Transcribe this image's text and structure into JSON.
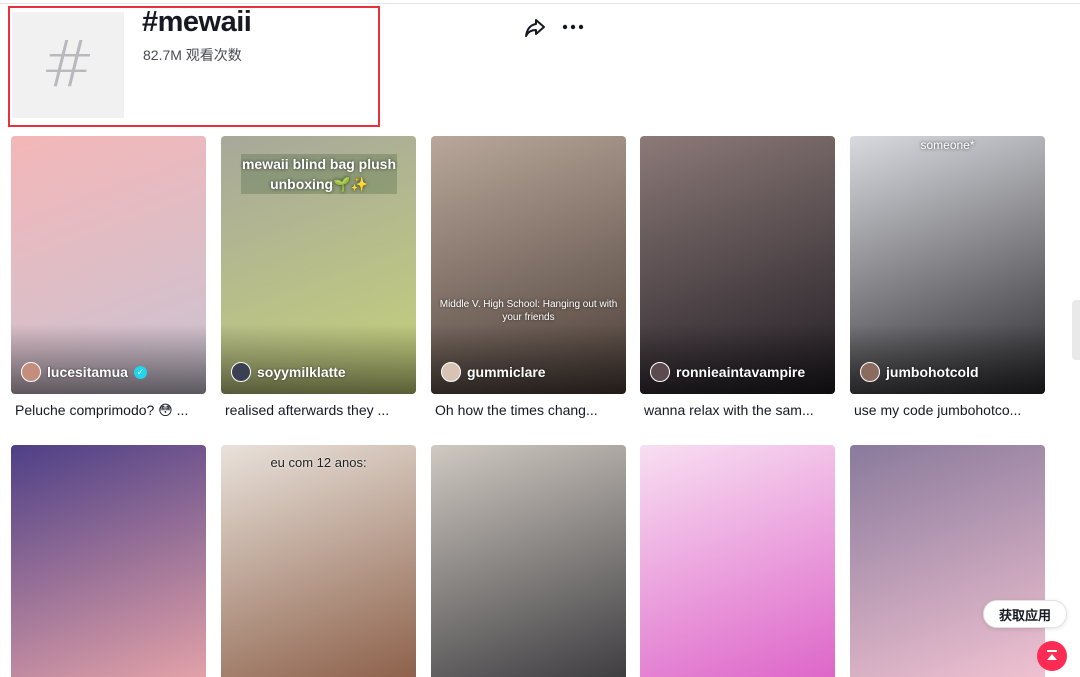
{
  "tag": {
    "title": "#mewaii",
    "views": "82.7M 观看次数",
    "icon": "hashtag-icon"
  },
  "actions": {
    "share_icon": "share-arrow-icon",
    "more_icon": "more-dots-icon"
  },
  "videos": [
    {
      "username": "lucesitamua",
      "verified": true,
      "caption": "Peluche comprimodo? 😳 ...",
      "overlay": "",
      "bg": "#f4b7b8",
      "bg2": "#c9c3d3"
    },
    {
      "username": "soyymilklatte",
      "verified": false,
      "caption": "realised afterwards they ...",
      "overlay": "mewaii blind bag plush unboxing🌱✨",
      "bg": "#a7a89b",
      "bg2": "#c7d27a"
    },
    {
      "username": "gummiclare",
      "verified": false,
      "caption": "Oh how the times chang...",
      "overlay": "Middle V. High School: Hanging out with your friends",
      "bg": "#b9a79a",
      "bg2": "#4a3d37"
    },
    {
      "username": "ronnieaintavampire",
      "verified": false,
      "caption": "wanna relax with the sam...",
      "overlay": "",
      "bg": "#8c7a78",
      "bg2": "#1f1b22"
    },
    {
      "username": "jumbohotcold",
      "verified": false,
      "caption": "use my code jumbohotco...",
      "overlay": "someone*",
      "bg": "#d9dadf",
      "bg2": "#2b2a2e"
    },
    {
      "username": "",
      "verified": false,
      "caption": "",
      "overlay": "",
      "bg": "#4d3f86",
      "bg2": "#e6a4a9"
    },
    {
      "username": "",
      "verified": false,
      "caption": "",
      "overlay": "eu com 12 anos:",
      "bg": "#e9e2db",
      "bg2": "#8b5e47"
    },
    {
      "username": "",
      "verified": false,
      "caption": "",
      "overlay": "",
      "bg": "#cfc9c1",
      "bg2": "#3b3a3e"
    },
    {
      "username": "",
      "verified": false,
      "caption": "",
      "overlay": "",
      "bg": "#f8dff2",
      "bg2": "#dd63c8"
    },
    {
      "username": "",
      "verified": false,
      "caption": "",
      "overlay": "",
      "bg": "#8a7a9c",
      "bg2": "#f2c3d2"
    }
  ],
  "floating": {
    "get_app": "获取应用",
    "to_top_icon": "arrow-up-icon"
  }
}
